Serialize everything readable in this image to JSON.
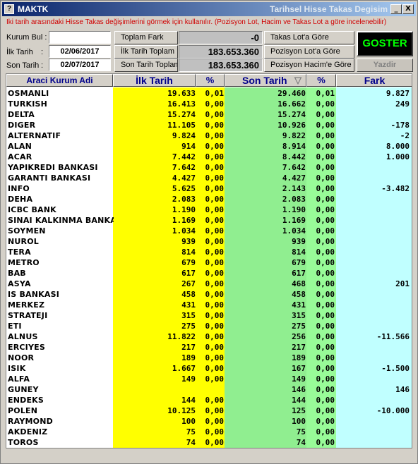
{
  "window": {
    "app_title": "MAKTK",
    "right_title": "Tarihsel Hisse Takas Degisim",
    "minimize": "_",
    "maximize": "□",
    "close": "X"
  },
  "hint": "İki tarih arasındaki Hisse Takas değişimlerini görmek için kullanılır. (Pozisyon Lot, Hacim ve Takas Lot a göre incelenebilir)",
  "form": {
    "kurum_bul_label": "Kurum Bul :",
    "kurum_bul_value": "",
    "ilk_tarih_label": "İlk Tarih",
    "ilk_tarih_colon": ":",
    "ilk_tarih_value": "02/06/2017",
    "son_tarih_label": "Son Tarih",
    "son_tarih_colon": ":",
    "son_tarih_value": "02/07/2017"
  },
  "summary": {
    "toplam_fark_label": "Toplam Fark",
    "toplam_fark_value": "-0",
    "ilk_toplam_label": "İlk Tarih Toplam",
    "ilk_toplam_value": "183.653.360",
    "son_toplam_label": "Son Tarih Toplam",
    "son_toplam_value": "183.653.360"
  },
  "buttons": {
    "takas_lot": "Takas Lot'a Göre",
    "pozisyon_lot": "Pozisyon Lot'a Göre",
    "pozisyon_hacim": "Pozisyon Hacim'e Göre",
    "goster": "GOSTER",
    "yazdir": "Yazdir"
  },
  "colors": {
    "yellow": "#ffff00",
    "green": "#90ee90",
    "cyan": "#c0ffff",
    "pct_green": "#98fb98"
  },
  "table": {
    "headers": {
      "name": "Araci Kurum Adi",
      "ilk": "İlk Tarih",
      "p1": "%",
      "son": "Son Tarih",
      "sort_icon": "▽",
      "p2": "%",
      "fark": "Fark"
    },
    "rows": [
      {
        "name": "OSMANLI",
        "ilk": "19.633",
        "p1": "0,01",
        "son": "29.460",
        "p2": "0,01",
        "fark": "9.827"
      },
      {
        "name": "TURKISH",
        "ilk": "16.413",
        "p1": "0,00",
        "son": "16.662",
        "p2": "0,00",
        "fark": "249"
      },
      {
        "name": "DELTA",
        "ilk": "15.274",
        "p1": "0,00",
        "son": "15.274",
        "p2": "0,00",
        "fark": ""
      },
      {
        "name": "DIGER",
        "ilk": "11.105",
        "p1": "0,00",
        "son": "10.926",
        "p2": "0,00",
        "fark": "-178"
      },
      {
        "name": "ALTERNATIF",
        "ilk": "9.824",
        "p1": "0,00",
        "son": "9.822",
        "p2": "0,00",
        "fark": "-2"
      },
      {
        "name": "ALAN",
        "ilk": "914",
        "p1": "0,00",
        "son": "8.914",
        "p2": "0,00",
        "fark": "8.000"
      },
      {
        "name": "ACAR",
        "ilk": "7.442",
        "p1": "0,00",
        "son": "8.442",
        "p2": "0,00",
        "fark": "1.000"
      },
      {
        "name": "YAPIKREDI BANKASI",
        "ilk": "7.642",
        "p1": "0,00",
        "son": "7.642",
        "p2": "0,00",
        "fark": ""
      },
      {
        "name": "GARANTI BANKASI",
        "ilk": "4.427",
        "p1": "0,00",
        "son": "4.427",
        "p2": "0,00",
        "fark": ""
      },
      {
        "name": "INFO",
        "ilk": "5.625",
        "p1": "0,00",
        "son": "2.143",
        "p2": "0,00",
        "fark": "-3.482"
      },
      {
        "name": "DEHA",
        "ilk": "2.083",
        "p1": "0,00",
        "son": "2.083",
        "p2": "0,00",
        "fark": ""
      },
      {
        "name": "ICBC BANK",
        "ilk": "1.190",
        "p1": "0,00",
        "son": "1.190",
        "p2": "0,00",
        "fark": ""
      },
      {
        "name": "SINAI KALKINMA BANKASI",
        "ilk": "1.169",
        "p1": "0,00",
        "son": "1.169",
        "p2": "0,00",
        "fark": ""
      },
      {
        "name": "SOYMEN",
        "ilk": "1.034",
        "p1": "0,00",
        "son": "1.034",
        "p2": "0,00",
        "fark": ""
      },
      {
        "name": "NUROL",
        "ilk": "939",
        "p1": "0,00",
        "son": "939",
        "p2": "0,00",
        "fark": ""
      },
      {
        "name": "TERA",
        "ilk": "814",
        "p1": "0,00",
        "son": "814",
        "p2": "0,00",
        "fark": ""
      },
      {
        "name": "METRO",
        "ilk": "679",
        "p1": "0,00",
        "son": "679",
        "p2": "0,00",
        "fark": ""
      },
      {
        "name": "BAB",
        "ilk": "617",
        "p1": "0,00",
        "son": "617",
        "p2": "0,00",
        "fark": ""
      },
      {
        "name": "ASYA",
        "ilk": "267",
        "p1": "0,00",
        "son": "468",
        "p2": "0,00",
        "fark": "201"
      },
      {
        "name": "IS BANKASI",
        "ilk": "458",
        "p1": "0,00",
        "son": "458",
        "p2": "0,00",
        "fark": ""
      },
      {
        "name": "MERKEZ",
        "ilk": "431",
        "p1": "0,00",
        "son": "431",
        "p2": "0,00",
        "fark": ""
      },
      {
        "name": "STRATEJI",
        "ilk": "315",
        "p1": "0,00",
        "son": "315",
        "p2": "0,00",
        "fark": ""
      },
      {
        "name": "ETI",
        "ilk": "275",
        "p1": "0,00",
        "son": "275",
        "p2": "0,00",
        "fark": ""
      },
      {
        "name": "ALNUS",
        "ilk": "11.822",
        "p1": "0,00",
        "son": "256",
        "p2": "0,00",
        "fark": "-11.566"
      },
      {
        "name": "ERCIYES",
        "ilk": "217",
        "p1": "0,00",
        "son": "217",
        "p2": "0,00",
        "fark": ""
      },
      {
        "name": "NOOR",
        "ilk": "189",
        "p1": "0,00",
        "son": "189",
        "p2": "0,00",
        "fark": ""
      },
      {
        "name": "ISIK",
        "ilk": "1.667",
        "p1": "0,00",
        "son": "167",
        "p2": "0,00",
        "fark": "-1.500"
      },
      {
        "name": "ALFA",
        "ilk": "149",
        "p1": "0,00",
        "son": "149",
        "p2": "0,00",
        "fark": ""
      },
      {
        "name": "GUNEY",
        "ilk": "",
        "p1": "",
        "son": "146",
        "p2": "0,00",
        "fark": "146"
      },
      {
        "name": "ENDEKS",
        "ilk": "144",
        "p1": "0,00",
        "son": "144",
        "p2": "0,00",
        "fark": ""
      },
      {
        "name": "POLEN",
        "ilk": "10.125",
        "p1": "0,00",
        "son": "125",
        "p2": "0,00",
        "fark": "-10.000"
      },
      {
        "name": "RAYMOND",
        "ilk": "100",
        "p1": "0,00",
        "son": "100",
        "p2": "0,00",
        "fark": ""
      },
      {
        "name": "AKDENIZ",
        "ilk": "75",
        "p1": "0,00",
        "son": "75",
        "p2": "0,00",
        "fark": ""
      },
      {
        "name": "TOROS",
        "ilk": "74",
        "p1": "0,00",
        "son": "74",
        "p2": "0,00",
        "fark": ""
      }
    ]
  }
}
